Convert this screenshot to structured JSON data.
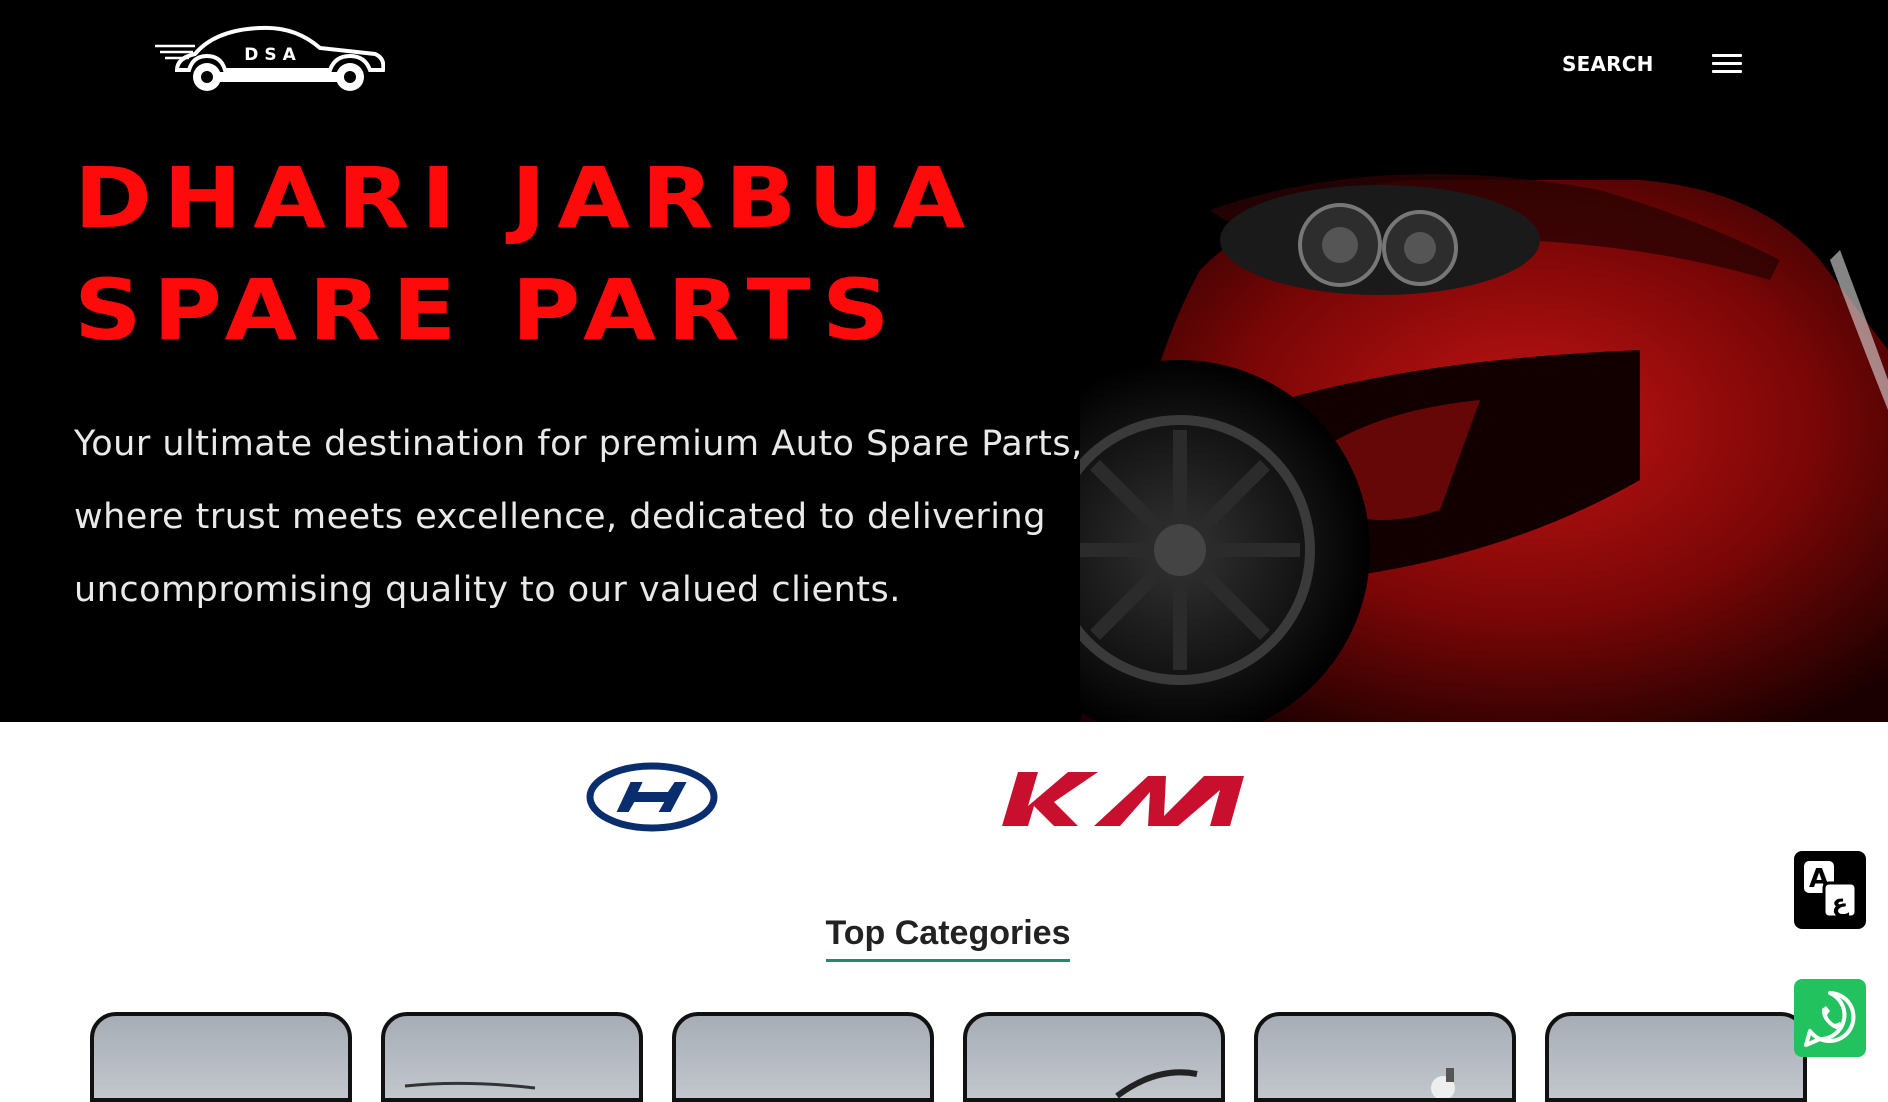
{
  "header": {
    "logo_text": "DSA",
    "search_label": "SEARCH",
    "menu_icon": "hamburger-menu-icon"
  },
  "hero": {
    "title_line1": "DHARI JARBUA",
    "title_line2": "SPARE PARTS",
    "description": "Your ultimate destination for premium Auto Spare Parts, where trust meets excellence, dedicated to delivering uncompromising quality to our valued clients.",
    "title_color": "#ff0a0a"
  },
  "brands": [
    {
      "name": "Hyundai",
      "icon": "hyundai-logo",
      "color": "#0a2d6e"
    },
    {
      "name": "KIA",
      "icon": "kia-logo",
      "color": "#c8102e"
    }
  ],
  "categories_section": {
    "title": "Top Categories",
    "accent_color": "#1e8a6e",
    "card_count": 6
  },
  "floating_buttons": [
    {
      "name": "translate",
      "icon": "translate-icon",
      "color": "#000000"
    },
    {
      "name": "whatsapp",
      "icon": "whatsapp-icon",
      "color": "#22c35e"
    }
  ]
}
